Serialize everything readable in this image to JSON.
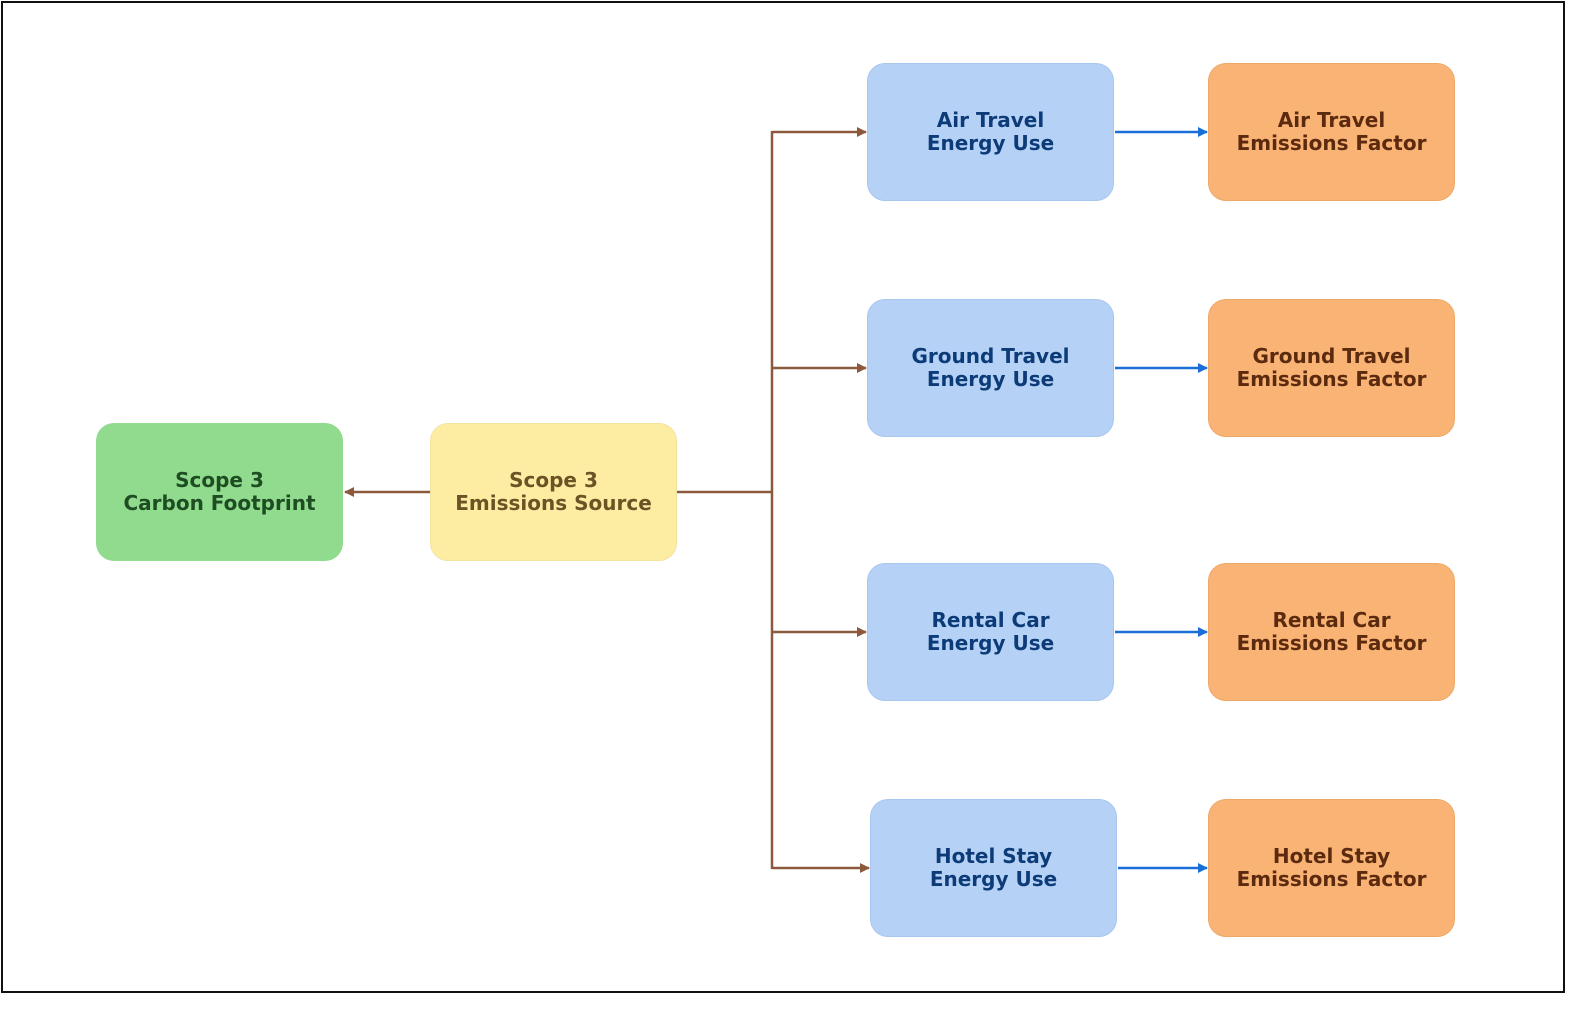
{
  "colors": {
    "root": "#90db8d",
    "source": "#fdeda3",
    "energy": "#b5d2f6",
    "factor": "#f8b375",
    "brown_arrow": "#8b5a3c",
    "blue_arrow": "#1a6fd8"
  },
  "nodes": {
    "footprint": {
      "line1": "Scope 3",
      "line2": "Carbon Footprint"
    },
    "source": {
      "line1": "Scope 3",
      "line2": "Emissions Source"
    },
    "rows": [
      {
        "energy": {
          "line1": "Air Travel",
          "line2": "Energy Use"
        },
        "factor": {
          "line1": "Air Travel",
          "line2": "Emissions Factor"
        }
      },
      {
        "energy": {
          "line1": "Ground Travel",
          "line2": "Energy Use"
        },
        "factor": {
          "line1": "Ground Travel",
          "line2": "Emissions Factor"
        }
      },
      {
        "energy": {
          "line1": "Rental Car",
          "line2": "Energy Use"
        },
        "factor": {
          "line1": "Rental Car",
          "line2": "Emissions Factor"
        }
      },
      {
        "energy": {
          "line1": "Hotel Stay",
          "line2": "Energy Use"
        },
        "factor": {
          "line1": "Hotel Stay",
          "line2": "Emissions Factor"
        }
      }
    ]
  }
}
